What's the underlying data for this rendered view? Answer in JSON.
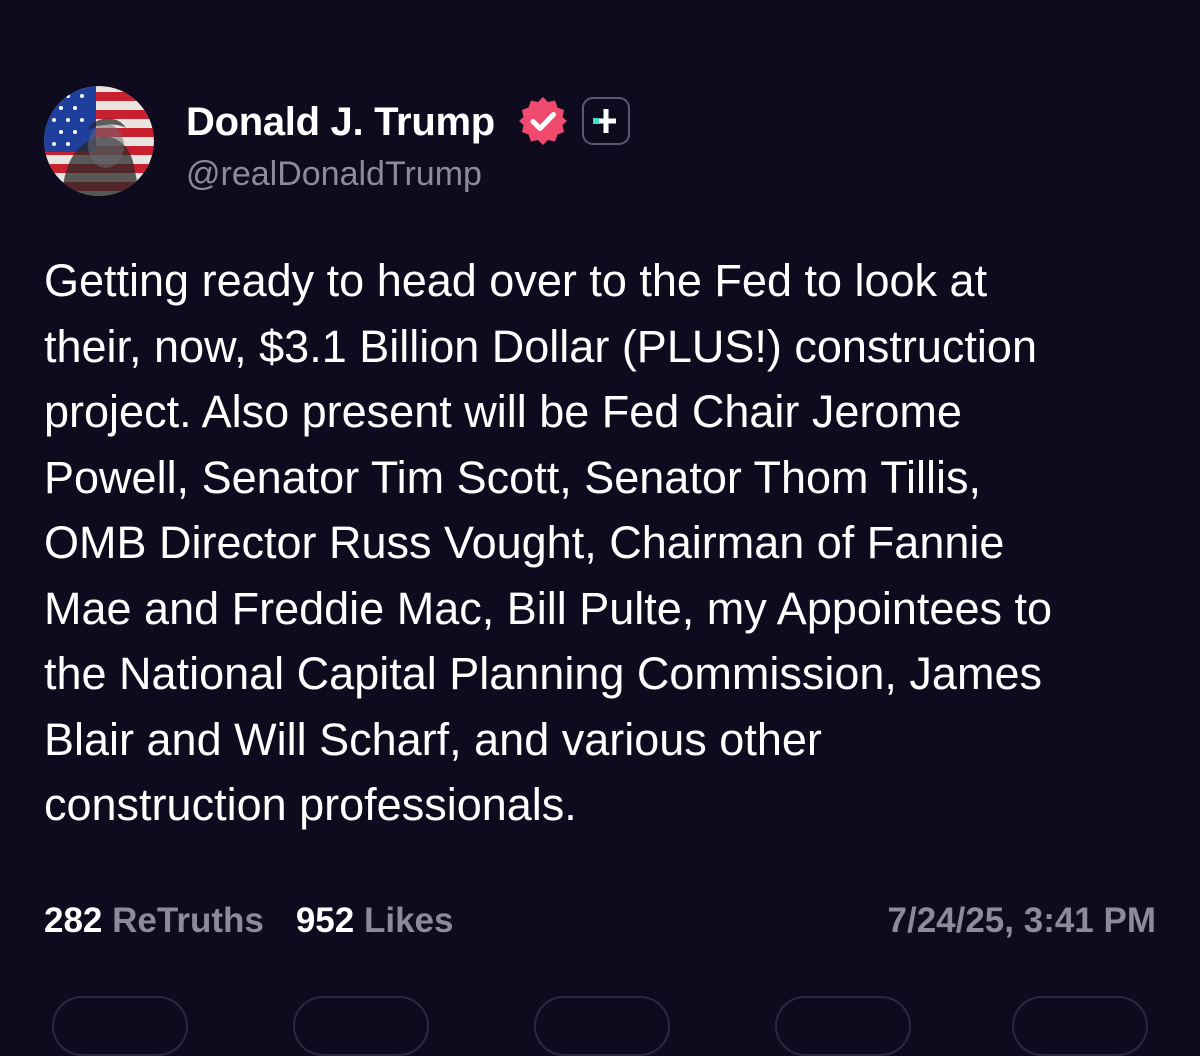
{
  "author": {
    "display_name": "Donald J. Trump",
    "handle": "@realDonaldTrump",
    "avatar_icon": "flag-portrait-avatar",
    "verified_icon": "verified-badge-icon",
    "plus_icon": "plus-subscription-icon"
  },
  "post": {
    "text": "Getting ready to head over to the Fed to look at\ntheir, now, $3.1 Billion Dollar (PLUS!) construction\nproject. Also present will be Fed Chair Jerome\nPowell, Senator Tim Scott, Senator Thom Tillis,\nOMB Director Russ Vought, Chairman of Fannie\nMae and Freddie Mac, Bill Pulte, my Appointees to\nthe National Capital Planning Commission, James\nBlair and Will Scharf, and various other\nconstruction professionals."
  },
  "stats": {
    "retruths_count": "282",
    "retruths_label": "ReTruths",
    "likes_count": "952",
    "likes_label": "Likes"
  },
  "timestamp": "7/24/25, 3:41 PM",
  "colors": {
    "background": "#0e0b1f",
    "verified": "#f04a6e",
    "plus_accent": "#3fe0c5",
    "muted_text": "#8e8a9e"
  }
}
